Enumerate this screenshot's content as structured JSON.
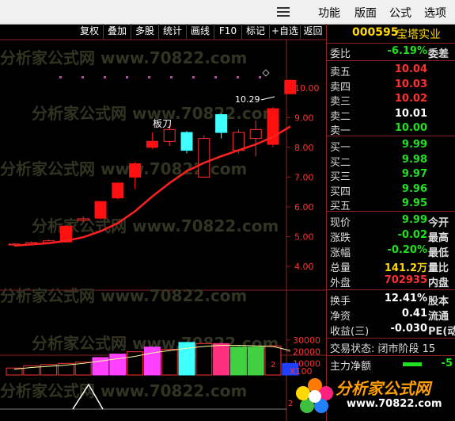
{
  "menubar": {
    "items": [
      "功能",
      "版面",
      "公式",
      "选项"
    ]
  },
  "toolbar": {
    "buttons": [
      "复权",
      "叠加",
      "多股",
      "统计",
      "画线",
      "F10",
      "标记",
      "+自选",
      "返回"
    ]
  },
  "chart": {
    "annotation_label": "板刀",
    "high_label": "10.29",
    "price_ticks": [
      "10.00",
      "9.00",
      "8.00",
      "7.00",
      "6.00",
      "5.00",
      "4.00"
    ],
    "volume_ticks": [
      "30000",
      "20000",
      "10000"
    ],
    "volume_unit": "X100",
    "indicator_label": "2",
    "watermark": "分析家公式网 www.70822.com",
    "candles": [
      {
        "o": 4.72,
        "c": 4.75,
        "h": 4.78,
        "l": 4.7,
        "t": "up",
        "v": 6000
      },
      {
        "o": 4.74,
        "c": 4.8,
        "h": 4.84,
        "l": 4.71,
        "t": "up",
        "v": 8000
      },
      {
        "o": 4.8,
        "c": 4.86,
        "h": 4.9,
        "l": 4.77,
        "t": "up",
        "v": 9000
      },
      {
        "o": 4.82,
        "c": 5.35,
        "h": 5.38,
        "l": 4.8,
        "t": "limit",
        "v": 10000
      },
      {
        "o": 5.55,
        "c": 5.6,
        "h": 5.68,
        "l": 5.5,
        "t": "up",
        "v": 11000
      },
      {
        "o": 5.62,
        "c": 6.18,
        "h": 6.2,
        "l": 5.58,
        "t": "limit",
        "v": 15000
      },
      {
        "o": 6.3,
        "c": 6.8,
        "h": 6.82,
        "l": 6.25,
        "t": "limit",
        "v": 18000
      },
      {
        "o": 7.0,
        "c": 7.45,
        "h": 7.5,
        "l": 6.6,
        "t": "limit",
        "v": 20000
      },
      {
        "o": 8.0,
        "c": 8.2,
        "h": 8.5,
        "l": 7.95,
        "t": "limit",
        "v": 24000
      },
      {
        "o": 8.2,
        "c": 8.6,
        "h": 8.75,
        "l": 8.05,
        "t": "up",
        "v": 22000
      },
      {
        "o": 8.5,
        "c": 7.9,
        "h": 8.55,
        "l": 7.8,
        "t": "down",
        "v": 28000
      },
      {
        "o": 7.0,
        "c": 8.3,
        "h": 8.4,
        "l": 7.0,
        "t": "up",
        "v": 27000
      },
      {
        "o": 8.5,
        "c": 9.1,
        "h": 9.15,
        "l": 8.3,
        "t": "down",
        "v": 27000
      },
      {
        "o": 7.9,
        "c": 8.5,
        "h": 8.6,
        "l": 7.8,
        "t": "up",
        "v": 24000
      },
      {
        "o": 8.3,
        "c": 8.6,
        "h": 8.9,
        "l": 7.7,
        "t": "up",
        "v": 24000
      },
      {
        "o": 8.1,
        "c": 9.3,
        "h": 9.35,
        "l": 8.0,
        "t": "limit",
        "v": 25000
      },
      {
        "o": 9.8,
        "c": 10.25,
        "h": 10.29,
        "l": 9.8,
        "t": "limit",
        "v": 10000
      }
    ],
    "vol_colors": [
      "up",
      "up",
      "up",
      "up",
      "up",
      "magenta",
      "magenta",
      "up",
      "magenta",
      "up",
      "cyan",
      "up",
      "pink",
      "green",
      "green",
      "up",
      "blue"
    ]
  },
  "quote": {
    "code": "000595",
    "name": "宝塔实业",
    "rows_top": [
      {
        "label": "委比",
        "value": "-6.19%",
        "extra": "委差",
        "vc": "green"
      }
    ],
    "asks": [
      {
        "label": "卖五",
        "value": "10.04",
        "vc": "red"
      },
      {
        "label": "卖四",
        "value": "10.03",
        "vc": "red"
      },
      {
        "label": "卖三",
        "value": "10.02",
        "vc": "red"
      },
      {
        "label": "卖二",
        "value": "10.01",
        "vc": "white"
      },
      {
        "label": "卖一",
        "value": "10.00",
        "vc": "green"
      }
    ],
    "bids": [
      {
        "label": "买一",
        "value": "9.99",
        "vc": "green"
      },
      {
        "label": "买二",
        "value": "9.98",
        "vc": "green"
      },
      {
        "label": "买三",
        "value": "9.97",
        "vc": "green"
      },
      {
        "label": "买四",
        "value": "9.96",
        "vc": "green"
      },
      {
        "label": "买五",
        "value": "9.95",
        "vc": "green"
      }
    ],
    "stats": [
      {
        "label": "现价",
        "value": "9.99",
        "extra": "今开",
        "vc": "green"
      },
      {
        "label": "涨跌",
        "value": "-0.02",
        "extra": "最高",
        "vc": "green"
      },
      {
        "label": "涨幅",
        "value": "-0.20%",
        "extra": "最低",
        "vc": "green"
      },
      {
        "label": "总量",
        "value": "141.2万",
        "extra": "量比",
        "vc": "yellow"
      },
      {
        "label": "外盘",
        "value": "702935",
        "extra": "内盘",
        "vc": "red"
      }
    ],
    "fin": [
      {
        "label": "换手",
        "value": "12.41%",
        "extra": "股本",
        "vc": "white"
      },
      {
        "label": "净资",
        "value": "0.41",
        "extra": "流通",
        "vc": "white"
      },
      {
        "label": "收益(三)",
        "value": "-0.030",
        "extra": "PE(动",
        "vc": "white"
      }
    ],
    "trade_status": "交易状态: 闭市阶段 15",
    "main_flow_label": "主力净额",
    "main_flow_value": "-5"
  },
  "logo": {
    "text": "分析家公式网",
    "url": "www.70822.com"
  },
  "colors": {
    "up": "#ff3030",
    "down": "#40ffff",
    "limit": "#ff1010",
    "ma": "#ff2020",
    "magenta": "#ff40ff",
    "cyan": "#40ffff",
    "green": "#40d040",
    "blue": "#2040ff",
    "pink": "#ff3080"
  }
}
